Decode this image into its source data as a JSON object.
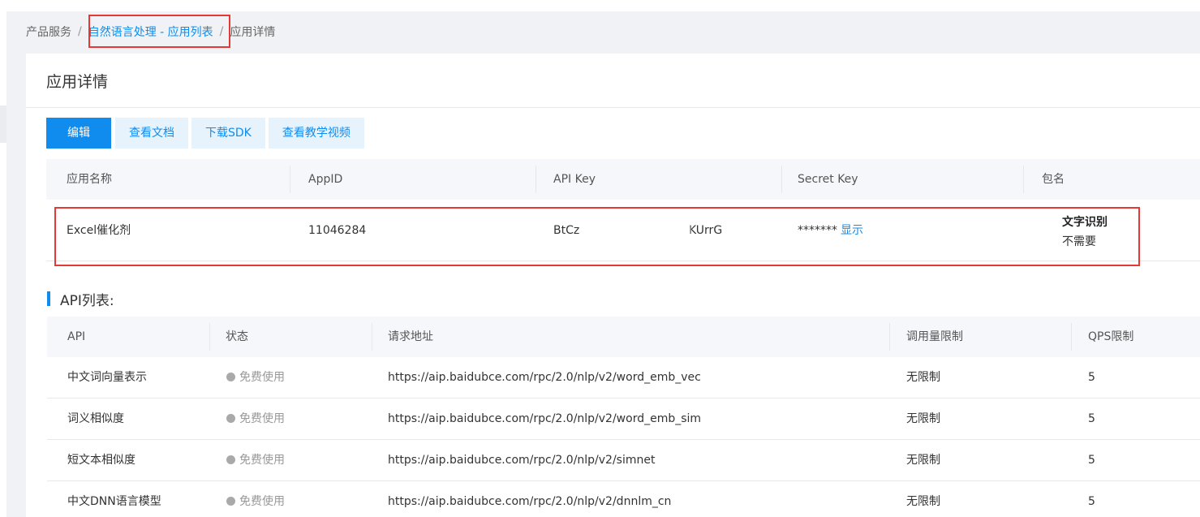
{
  "breadcrumb": {
    "items": [
      "产品服务",
      "自然语言处理 - 应用列表",
      "应用详情"
    ],
    "separator": "/"
  },
  "card": {
    "title": "应用详情"
  },
  "buttons": {
    "edit": "编辑",
    "docs": "查看文档",
    "sdk": "下载SDK",
    "video": "查看教学视频"
  },
  "app_table": {
    "headers": [
      "应用名称",
      "AppID",
      "API Key",
      "Secret Key",
      "包名"
    ],
    "row": {
      "name": "Excel催化剂",
      "app_id": "11046284",
      "api_key_prefix": "BtCz",
      "api_key_suffix": "KUrrG",
      "secret_mask": "*******",
      "secret_show": "显示",
      "package_title": "文字识别",
      "package_value": "不需要"
    }
  },
  "api_section": {
    "title": "API列表:",
    "headers": [
      "API",
      "状态",
      "请求地址",
      "调用量限制",
      "QPS限制"
    ],
    "rows": [
      {
        "api": "中文词向量表示",
        "status": "免费使用",
        "url": "https://aip.baidubce.com/rpc/2.0/nlp/v2/word_emb_vec",
        "limit": "无限制",
        "qps": "5"
      },
      {
        "api": "词义相似度",
        "status": "免费使用",
        "url": "https://aip.baidubce.com/rpc/2.0/nlp/v2/word_emb_sim",
        "limit": "无限制",
        "qps": "5"
      },
      {
        "api": "短文本相似度",
        "status": "免费使用",
        "url": "https://aip.baidubce.com/rpc/2.0/nlp/v2/simnet",
        "limit": "无限制",
        "qps": "5"
      },
      {
        "api": "中文DNN语言模型",
        "status": "免费使用",
        "url": "https://aip.baidubce.com/rpc/2.0/nlp/v2/dnnlm_cn",
        "limit": "无限制",
        "qps": "5"
      }
    ]
  },
  "colors": {
    "accent": "#108cee",
    "highlight": "#e53935"
  }
}
